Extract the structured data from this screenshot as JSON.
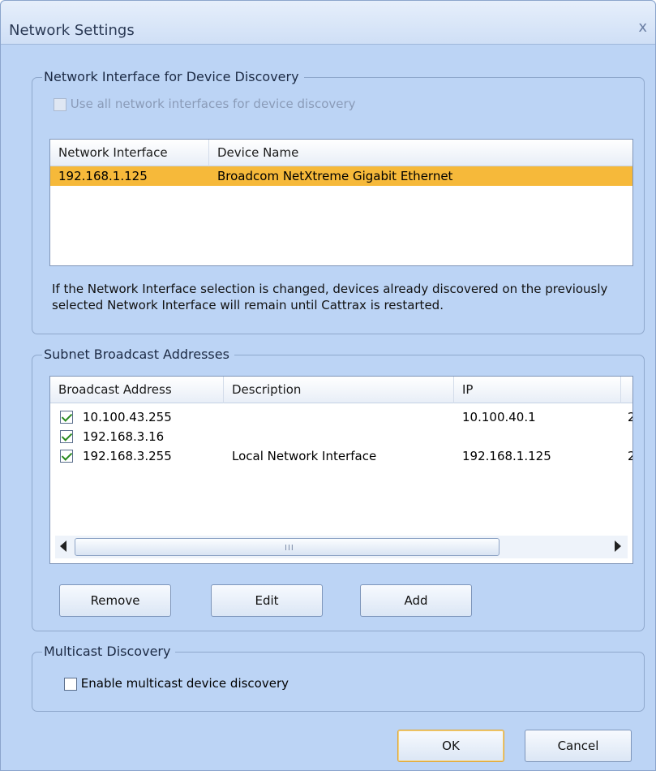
{
  "window": {
    "title": "Network Settings",
    "close_glyph": "x"
  },
  "network_interface": {
    "legend": "Network Interface for Device Discovery",
    "use_all_label": "Use all network interfaces for device discovery",
    "use_all_checked": false,
    "use_all_disabled": true,
    "columns": [
      "Network Interface",
      "Device Name"
    ],
    "rows": [
      {
        "interface": "192.168.1.125",
        "device": "Broadcom NetXtreme Gigabit Ethernet",
        "selected": true
      }
    ],
    "info_text": "If the Network Interface selection is changed, devices already discovered on the previously selected Network Interface will remain until Cattrax is restarted."
  },
  "subnet": {
    "legend": "Subnet Broadcast Addresses",
    "columns": [
      "Broadcast Address",
      "Description",
      "IP"
    ],
    "rows": [
      {
        "address": "10.100.43.255",
        "description": "",
        "ip": "10.100.40.1",
        "checked": true,
        "overflow": "2"
      },
      {
        "address": "192.168.3.16",
        "description": "",
        "ip": "",
        "checked": true,
        "overflow": ""
      },
      {
        "address": "192.168.3.255",
        "description": "Local Network Interface",
        "ip": "192.168.1.125",
        "checked": true,
        "overflow": "2"
      }
    ],
    "scroll_grip": "III",
    "buttons": {
      "remove": "Remove",
      "edit": "Edit",
      "add": "Add"
    }
  },
  "multicast": {
    "legend": "Multicast Discovery",
    "enable_label": "Enable multicast device discovery",
    "enable_checked": false
  },
  "footer": {
    "ok": "OK",
    "cancel": "Cancel"
  },
  "colors": {
    "window_bg": "#bcd4f5",
    "selection": "#f6b93a",
    "check": "#2a8a1f"
  }
}
